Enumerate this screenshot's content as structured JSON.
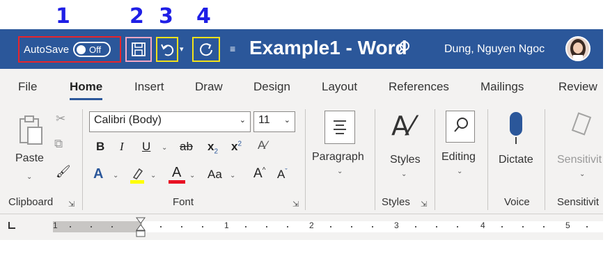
{
  "annotations": [
    "1",
    "2",
    "3",
    "4"
  ],
  "titlebar": {
    "autosave_label": "AutoSave",
    "toggle_state": "Off",
    "doc_title": "Example1 - Word",
    "user_name": "Dung, Nguyen Ngoc"
  },
  "tabs": [
    "File",
    "Home",
    "Insert",
    "Draw",
    "Design",
    "Layout",
    "References",
    "Mailings",
    "Review"
  ],
  "active_tab": "Home",
  "clipboard": {
    "paste_label": "Paste",
    "group": "Clipboard"
  },
  "font": {
    "font_name": "Calibri (Body)",
    "font_size": "11",
    "group": "Font",
    "btn_bold": "B",
    "btn_italic": "I",
    "btn_underline": "U",
    "btn_strike": "ab",
    "btn_sub": "x",
    "btn_sup": "x",
    "btn_case": "Aa",
    "btn_grow": "A",
    "btn_shrink": "A"
  },
  "paragraph": {
    "label": "Paragraph"
  },
  "styles": {
    "label": "Styles",
    "group": "Styles"
  },
  "editing": {
    "label": "Editing"
  },
  "voice": {
    "dictate_label": "Dictate",
    "group": "Voice"
  },
  "sensitivity": {
    "label": "Sensitivit",
    "group": "Sensitivit"
  },
  "ruler_numbers": [
    "1",
    "1",
    "2",
    "3",
    "4",
    "5"
  ],
  "colors": {
    "title_bar": "#2b579a",
    "highlight_yellow": "#ffff00",
    "font_red": "#e81123",
    "annotation_blue": "#1f1fe6"
  }
}
